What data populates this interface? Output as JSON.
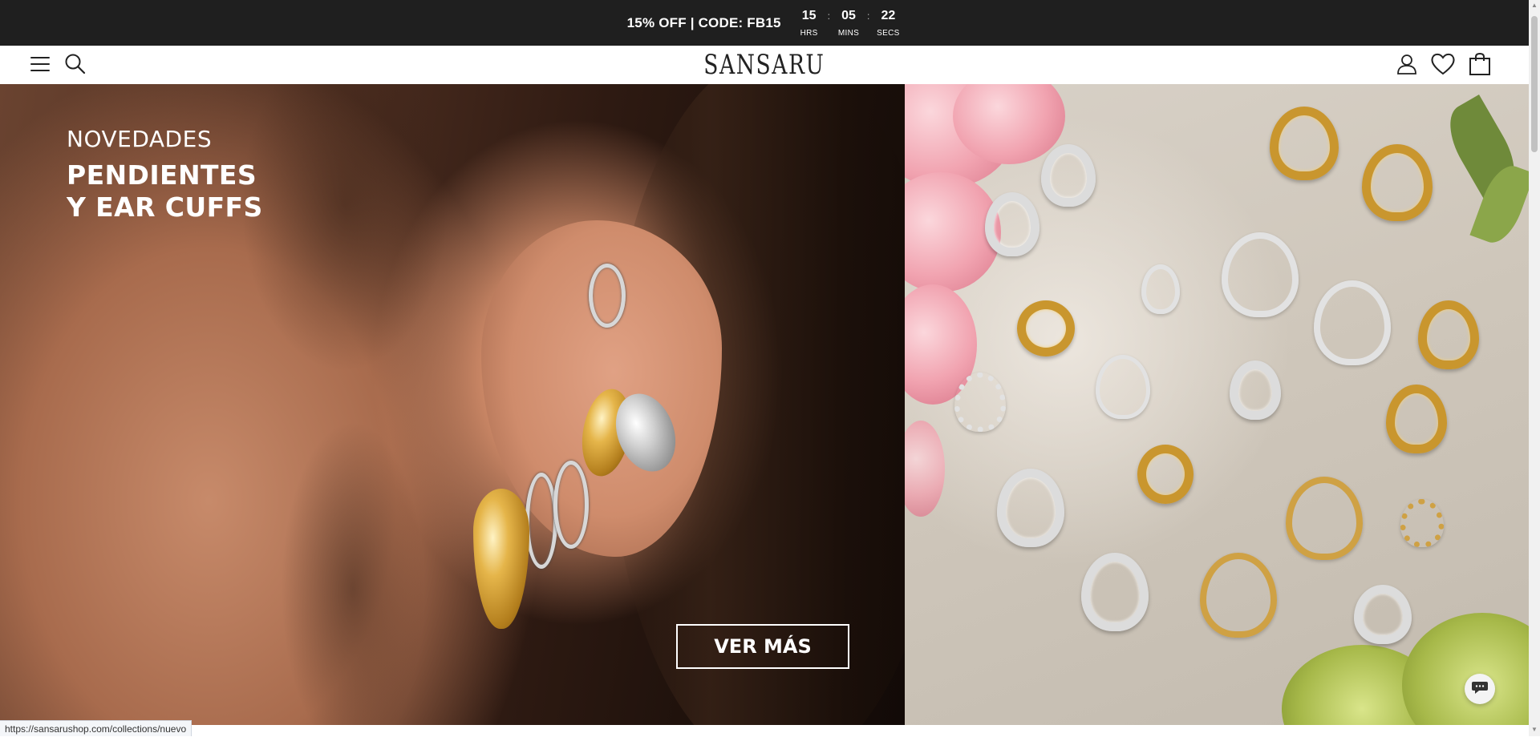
{
  "promo": {
    "text": "15% OFF | CODE: FB15",
    "countdown": {
      "hours": "15",
      "hours_label": "HRS",
      "minutes": "05",
      "minutes_label": "MINS",
      "seconds": "22",
      "seconds_label": "SECS",
      "separator": ":"
    }
  },
  "header": {
    "logo": "SANSARU",
    "icons": [
      "menu-icon",
      "search-icon",
      "account-icon",
      "wishlist-heart-icon",
      "cart-bag-icon"
    ]
  },
  "hero": {
    "kicker": "NOVEDADES",
    "heading_line1": "PENDIENTES",
    "heading_line2": "Y EAR CUFFS",
    "cta_label": "VER MÁS"
  },
  "status_bar": {
    "url": "https://sansarushop.com/collections/nuevo"
  },
  "colors": {
    "promo_bg": "#1f1f1f",
    "header_bg": "#ffffff",
    "text_light": "#ffffff"
  }
}
